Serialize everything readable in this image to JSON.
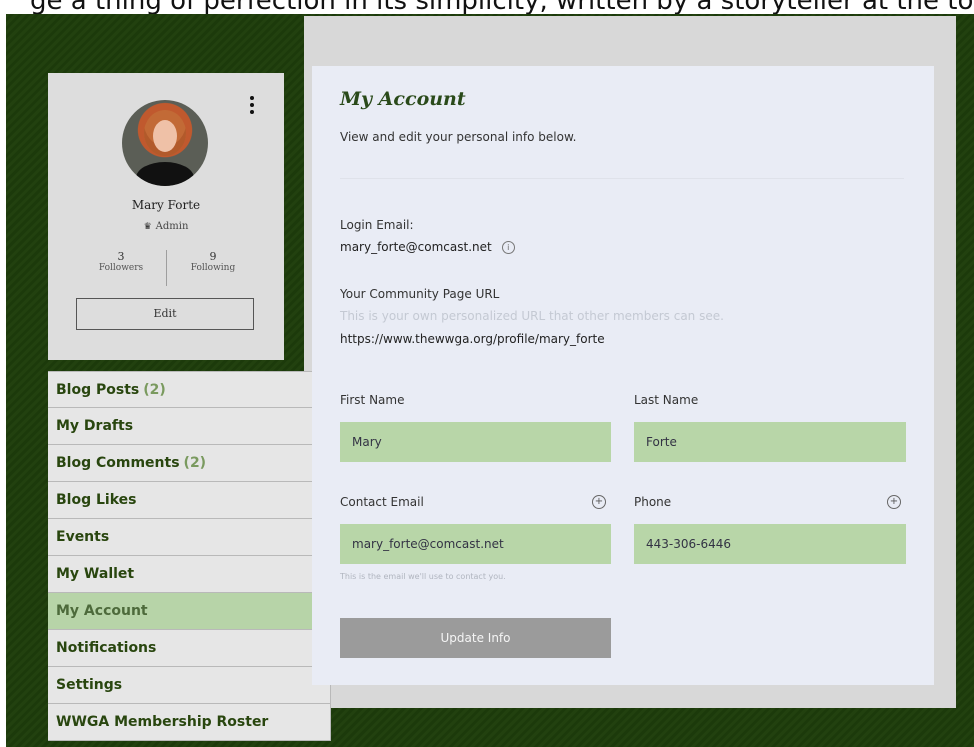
{
  "top_cut_text": "ge a thing of perfection in its simplicity, written by a storyteller at the top of her game.",
  "profile": {
    "name": "Mary Forte",
    "role": "Admin",
    "followers_count": "3",
    "followers_label": "Followers",
    "following_count": "9",
    "following_label": "Following",
    "edit_label": "Edit"
  },
  "menu": {
    "items": [
      {
        "label": "Blog Posts",
        "count": "(2)"
      },
      {
        "label": "My Drafts",
        "count": ""
      },
      {
        "label": "Blog Comments",
        "count": "(2)"
      },
      {
        "label": "Blog Likes",
        "count": ""
      },
      {
        "label": "Events",
        "count": ""
      },
      {
        "label": "My Wallet",
        "count": ""
      },
      {
        "label": "My Account",
        "count": ""
      },
      {
        "label": "Notifications",
        "count": ""
      },
      {
        "label": "Settings",
        "count": ""
      },
      {
        "label": "WWGA Membership Roster",
        "count": ""
      }
    ],
    "active_index": 6
  },
  "account": {
    "title": "My Account",
    "subtitle": "View and edit your personal info below.",
    "login_email_label": "Login Email:",
    "login_email_value": "mary_forte@comcast.net",
    "community_url_label": "Your Community Page URL",
    "community_url_hint": "This is your own personalized URL that other members can see.",
    "community_url_value": "https://www.thewwga.org/profile/mary_forte",
    "first_name_label": "First Name",
    "first_name_value": "Mary",
    "last_name_label": "Last Name",
    "last_name_value": "Forte",
    "contact_email_label": "Contact Email",
    "contact_email_value": "mary_forte@comcast.net",
    "contact_email_hint": "This is the email we'll use to contact you.",
    "phone_label": "Phone",
    "phone_value": "443-306-6446",
    "update_label": "Update Info"
  },
  "icons": {
    "more": "kebab-menu-icon",
    "info": "info-icon",
    "add": "plus-circle-icon",
    "crown": "crown-icon"
  },
  "colors": {
    "frame_green": "#22410f",
    "field_green": "#b8d6a8",
    "active_menu": "#b7d4a8",
    "content_bg": "#e9ecf5"
  }
}
